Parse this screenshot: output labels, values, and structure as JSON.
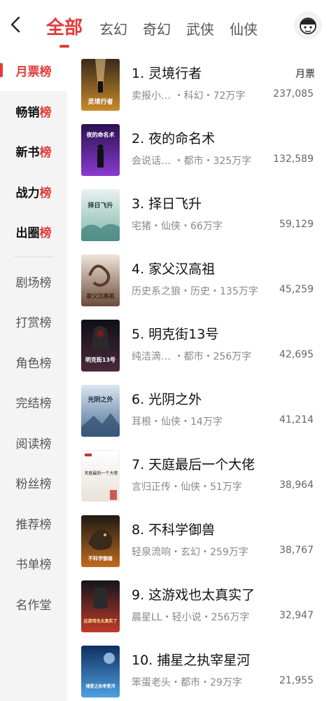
{
  "header": {
    "tabs": [
      {
        "label": "全部",
        "active": true
      },
      {
        "label": "玄幻",
        "active": false
      },
      {
        "label": "奇幻",
        "active": false
      },
      {
        "label": "武侠",
        "active": false
      },
      {
        "label": "仙侠",
        "active": false
      }
    ],
    "back_icon": "chevron-left-icon",
    "avatar_icon": "user-avatar-icon"
  },
  "sidebar": {
    "primary": [
      {
        "head": "月票",
        "tail": "榜",
        "active": true
      },
      {
        "head": "畅销",
        "tail": "榜",
        "active": false
      },
      {
        "head": "新书",
        "tail": "榜",
        "active": false
      },
      {
        "head": "战力",
        "tail": "榜",
        "active": false
      },
      {
        "head": "出圈",
        "tail": "榜",
        "active": false
      }
    ],
    "secondary": [
      "剧场榜",
      "打赏榜",
      "角色榜",
      "完结榜",
      "阅读榜",
      "粉丝榜",
      "推荐榜",
      "书单榜",
      "名作堂"
    ]
  },
  "list": {
    "metric_label": "月票",
    "books": [
      {
        "title": "1. 灵境行者",
        "meta": "卖报小… ・科幻・72万字",
        "value": "237,085"
      },
      {
        "title": "2. 夜的命名术",
        "meta": "会说话… ・都市・325万字",
        "value": "132,589"
      },
      {
        "title": "3. 择日飞升",
        "meta": "宅猪・仙侠・66万字",
        "value": "59,129"
      },
      {
        "title": "4. 家父汉高祖",
        "meta": "历史系之狼・历史・135万字",
        "value": "45,259"
      },
      {
        "title": "5. 明克街13号",
        "meta": "纯洁滴… ・都市・256万字",
        "value": "42,695"
      },
      {
        "title": "6. 光阴之外",
        "meta": "耳根・仙侠・14万字",
        "value": "41,214"
      },
      {
        "title": "7. 天庭最后一个大佬",
        "meta": "言归正传・仙侠・51万字",
        "value": "38,964"
      },
      {
        "title": "8. 不科学御兽",
        "meta": "轻泉流响・玄幻・259万字",
        "value": "38,767"
      },
      {
        "title": "9. 这游戏也太真实了",
        "meta": "晨星LL・轻小说・256万字",
        "value": "32,947"
      },
      {
        "title": "10. 捕星之执宰星河",
        "meta": "笨蛋老头・都市・29万字",
        "value": "21,955"
      }
    ]
  },
  "covers": {
    "c1": {
      "text": "灵境行者",
      "bg1": "#3a2a1a",
      "bg2": "#c98a2a"
    },
    "c2": {
      "text": "夜的命名术",
      "bg1": "#2a1050",
      "bg2": "#8a3bd0"
    },
    "c3": {
      "text": "择日飞升",
      "bg1": "#e8f1f0",
      "bg2": "#7fb6a9"
    },
    "c4": {
      "text": "家父汉高祖",
      "bg1": "#efe6da",
      "bg2": "#6b4a3a"
    },
    "c5": {
      "text": "明克街13号",
      "bg1": "#0e0f18",
      "bg2": "#4a2a3a"
    },
    "c6": {
      "text": "光阴之外",
      "bg1": "#dbe6f2",
      "bg2": "#4a6e94"
    },
    "c7": {
      "text": "天庭最后一个大佬",
      "bg1": "#ffffff",
      "bg2": "#e8e1d6"
    },
    "c8": {
      "text": "不科学御兽",
      "bg1": "#1d1a14",
      "bg2": "#c26a1e"
    },
    "c9": {
      "text": "这游戏也太真实了",
      "bg1": "#12151c",
      "bg2": "#c03a2a"
    },
    "c10": {
      "text": "捕星之执宰星河",
      "bg1": "#0f2f60",
      "bg2": "#4fa0e0"
    }
  },
  "colors": {
    "accent": "#e43a3a",
    "sidebar_bg": "#f4f4f4"
  }
}
